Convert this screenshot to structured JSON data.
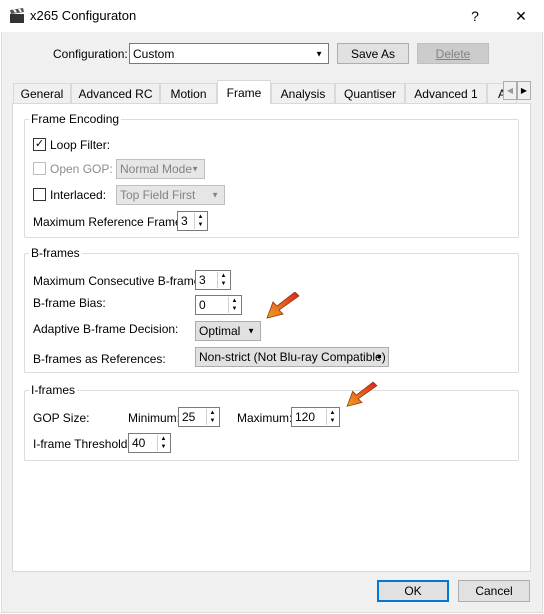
{
  "window": {
    "title": "x265 Configuraton",
    "help_glyph": "?",
    "close_glyph": "✕"
  },
  "config_row": {
    "label": "Configuration:",
    "value": "Custom",
    "save_as": "Save As",
    "delete": "Delete"
  },
  "tabs": [
    "General",
    "Advanced RC",
    "Motion",
    "Frame",
    "Analysis",
    "Quantiser",
    "Advanced 1",
    "A"
  ],
  "active_tab": "Frame",
  "frame_encoding": {
    "title": "Frame Encoding",
    "loop_filter": {
      "label": "Loop Filter:",
      "checked": true
    },
    "open_gop": {
      "label": "Open GOP:",
      "value": "Normal Mode"
    },
    "interlaced": {
      "label": "Interlaced:",
      "value": "Top Field First"
    },
    "max_ref": {
      "label": "Maximum Reference Frames:",
      "value": "3"
    }
  },
  "bframes": {
    "title": "B-frames",
    "max_consecutive": {
      "label": "Maximum Consecutive B-frames:",
      "value": "3"
    },
    "bias": {
      "label": "B-frame Bias:",
      "value": "0"
    },
    "adaptive": {
      "label": "Adaptive B-frame Decision:",
      "value": "Optimal"
    },
    "as_references": {
      "label": "B-frames as References:",
      "value": "Non-strict (Not Blu-ray Compatible)"
    }
  },
  "iframes": {
    "title": "I-frames",
    "gop_label": "GOP Size:",
    "min_label": "Minimum:",
    "min_value": "25",
    "max_label": "Maximum:",
    "max_value": "120",
    "threshold_label": "I-frame Threshold:",
    "threshold_value": "40"
  },
  "footer": {
    "ok": "OK",
    "cancel": "Cancel"
  },
  "colors": {
    "accent": "#0078d7",
    "arrow_red": "#e0201e",
    "arrow_orange": "#f0a020"
  }
}
